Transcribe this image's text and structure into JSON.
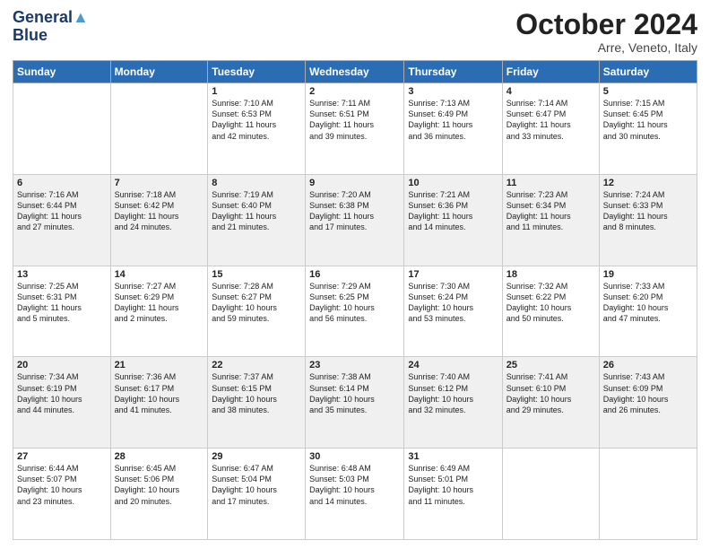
{
  "header": {
    "logo_line1": "General",
    "logo_line2": "Blue",
    "month": "October 2024",
    "location": "Arre, Veneto, Italy"
  },
  "days_of_week": [
    "Sunday",
    "Monday",
    "Tuesday",
    "Wednesday",
    "Thursday",
    "Friday",
    "Saturday"
  ],
  "weeks": [
    [
      {
        "day": "",
        "info": ""
      },
      {
        "day": "",
        "info": ""
      },
      {
        "day": "1",
        "info": "Sunrise: 7:10 AM\nSunset: 6:53 PM\nDaylight: 11 hours\nand 42 minutes."
      },
      {
        "day": "2",
        "info": "Sunrise: 7:11 AM\nSunset: 6:51 PM\nDaylight: 11 hours\nand 39 minutes."
      },
      {
        "day": "3",
        "info": "Sunrise: 7:13 AM\nSunset: 6:49 PM\nDaylight: 11 hours\nand 36 minutes."
      },
      {
        "day": "4",
        "info": "Sunrise: 7:14 AM\nSunset: 6:47 PM\nDaylight: 11 hours\nand 33 minutes."
      },
      {
        "day": "5",
        "info": "Sunrise: 7:15 AM\nSunset: 6:45 PM\nDaylight: 11 hours\nand 30 minutes."
      }
    ],
    [
      {
        "day": "6",
        "info": "Sunrise: 7:16 AM\nSunset: 6:44 PM\nDaylight: 11 hours\nand 27 minutes."
      },
      {
        "day": "7",
        "info": "Sunrise: 7:18 AM\nSunset: 6:42 PM\nDaylight: 11 hours\nand 24 minutes."
      },
      {
        "day": "8",
        "info": "Sunrise: 7:19 AM\nSunset: 6:40 PM\nDaylight: 11 hours\nand 21 minutes."
      },
      {
        "day": "9",
        "info": "Sunrise: 7:20 AM\nSunset: 6:38 PM\nDaylight: 11 hours\nand 17 minutes."
      },
      {
        "day": "10",
        "info": "Sunrise: 7:21 AM\nSunset: 6:36 PM\nDaylight: 11 hours\nand 14 minutes."
      },
      {
        "day": "11",
        "info": "Sunrise: 7:23 AM\nSunset: 6:34 PM\nDaylight: 11 hours\nand 11 minutes."
      },
      {
        "day": "12",
        "info": "Sunrise: 7:24 AM\nSunset: 6:33 PM\nDaylight: 11 hours\nand 8 minutes."
      }
    ],
    [
      {
        "day": "13",
        "info": "Sunrise: 7:25 AM\nSunset: 6:31 PM\nDaylight: 11 hours\nand 5 minutes."
      },
      {
        "day": "14",
        "info": "Sunrise: 7:27 AM\nSunset: 6:29 PM\nDaylight: 11 hours\nand 2 minutes."
      },
      {
        "day": "15",
        "info": "Sunrise: 7:28 AM\nSunset: 6:27 PM\nDaylight: 10 hours\nand 59 minutes."
      },
      {
        "day": "16",
        "info": "Sunrise: 7:29 AM\nSunset: 6:25 PM\nDaylight: 10 hours\nand 56 minutes."
      },
      {
        "day": "17",
        "info": "Sunrise: 7:30 AM\nSunset: 6:24 PM\nDaylight: 10 hours\nand 53 minutes."
      },
      {
        "day": "18",
        "info": "Sunrise: 7:32 AM\nSunset: 6:22 PM\nDaylight: 10 hours\nand 50 minutes."
      },
      {
        "day": "19",
        "info": "Sunrise: 7:33 AM\nSunset: 6:20 PM\nDaylight: 10 hours\nand 47 minutes."
      }
    ],
    [
      {
        "day": "20",
        "info": "Sunrise: 7:34 AM\nSunset: 6:19 PM\nDaylight: 10 hours\nand 44 minutes."
      },
      {
        "day": "21",
        "info": "Sunrise: 7:36 AM\nSunset: 6:17 PM\nDaylight: 10 hours\nand 41 minutes."
      },
      {
        "day": "22",
        "info": "Sunrise: 7:37 AM\nSunset: 6:15 PM\nDaylight: 10 hours\nand 38 minutes."
      },
      {
        "day": "23",
        "info": "Sunrise: 7:38 AM\nSunset: 6:14 PM\nDaylight: 10 hours\nand 35 minutes."
      },
      {
        "day": "24",
        "info": "Sunrise: 7:40 AM\nSunset: 6:12 PM\nDaylight: 10 hours\nand 32 minutes."
      },
      {
        "day": "25",
        "info": "Sunrise: 7:41 AM\nSunset: 6:10 PM\nDaylight: 10 hours\nand 29 minutes."
      },
      {
        "day": "26",
        "info": "Sunrise: 7:43 AM\nSunset: 6:09 PM\nDaylight: 10 hours\nand 26 minutes."
      }
    ],
    [
      {
        "day": "27",
        "info": "Sunrise: 6:44 AM\nSunset: 5:07 PM\nDaylight: 10 hours\nand 23 minutes."
      },
      {
        "day": "28",
        "info": "Sunrise: 6:45 AM\nSunset: 5:06 PM\nDaylight: 10 hours\nand 20 minutes."
      },
      {
        "day": "29",
        "info": "Sunrise: 6:47 AM\nSunset: 5:04 PM\nDaylight: 10 hours\nand 17 minutes."
      },
      {
        "day": "30",
        "info": "Sunrise: 6:48 AM\nSunset: 5:03 PM\nDaylight: 10 hours\nand 14 minutes."
      },
      {
        "day": "31",
        "info": "Sunrise: 6:49 AM\nSunset: 5:01 PM\nDaylight: 10 hours\nand 11 minutes."
      },
      {
        "day": "",
        "info": ""
      },
      {
        "day": "",
        "info": ""
      }
    ]
  ]
}
